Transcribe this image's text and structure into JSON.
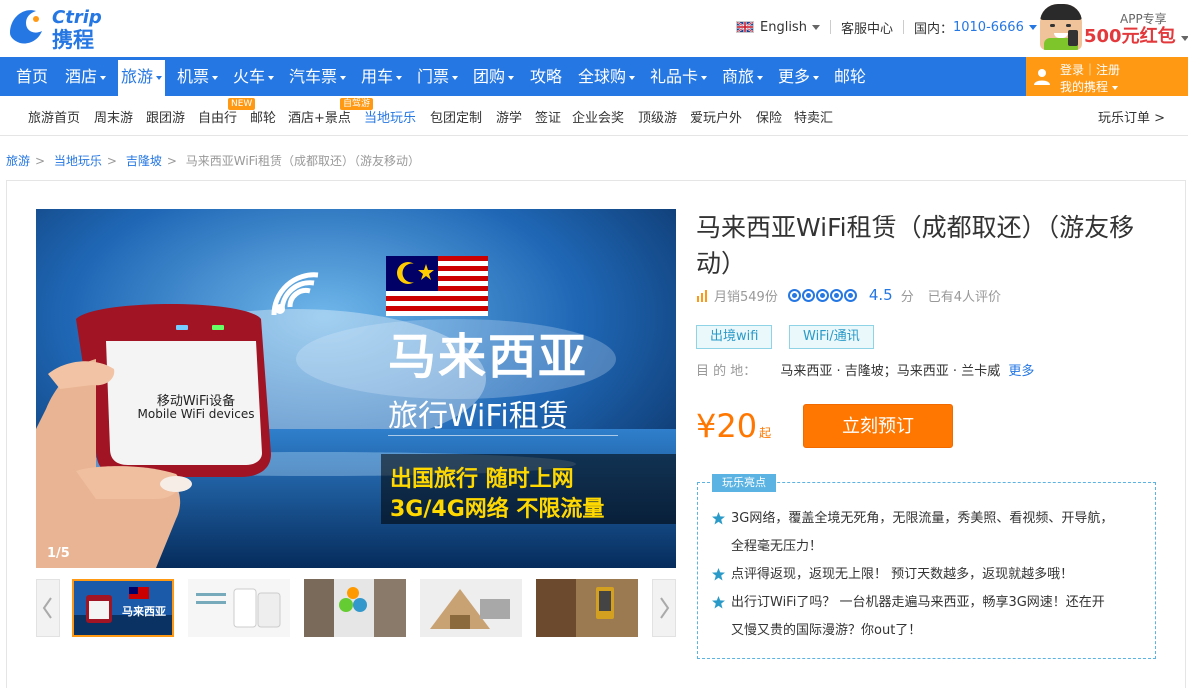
{
  "brand": {
    "name": "携程",
    "logo_text": "Ctrip"
  },
  "topbar": {
    "language": "English",
    "service": "客服中心",
    "phone_label": "国内：",
    "phone_number": "1010-6666",
    "promo_tag": "APP专享",
    "promo_money": "500元红包"
  },
  "mainnav": {
    "items": [
      {
        "label": "首页"
      },
      {
        "label": "酒店"
      },
      {
        "label": "旅游"
      },
      {
        "label": "机票"
      },
      {
        "label": "火车"
      },
      {
        "label": "汽车票"
      },
      {
        "label": "用车"
      },
      {
        "label": "门票"
      },
      {
        "label": "团购"
      },
      {
        "label": "攻略"
      },
      {
        "label": "全球购"
      },
      {
        "label": "礼品卡"
      },
      {
        "label": "商旅"
      },
      {
        "label": "更多"
      },
      {
        "label": "邮轮"
      }
    ],
    "login": "登录｜注册",
    "my_ctrip": "我的携程"
  },
  "subnav": {
    "items": [
      {
        "label": "旅游首页"
      },
      {
        "label": "周末游"
      },
      {
        "label": "跟团游"
      },
      {
        "label": "自由行"
      },
      {
        "label": "邮轮"
      },
      {
        "label": "酒店+景点"
      },
      {
        "label": "当地玩乐"
      },
      {
        "label": "包团定制"
      },
      {
        "label": "游学"
      },
      {
        "label": "签证"
      },
      {
        "label": "企业会奖"
      },
      {
        "label": "顶级游"
      },
      {
        "label": "爱玩户外"
      },
      {
        "label": "保险"
      },
      {
        "label": "特卖汇"
      }
    ],
    "badge_new": "NEW",
    "badge_self_drive": "自驾游",
    "orders": "玩乐订单 >"
  },
  "breadcrumb": {
    "items": [
      "旅游",
      "当地玩乐",
      "吉隆坡"
    ],
    "current": "马来西亚WiFi租赁（成都取还）（游友移动）"
  },
  "gallery": {
    "counter": "1/5",
    "hero_device_cn": "移动WiFi设备",
    "hero_device_en": "Mobile WiFi devices",
    "hero_title": "马来西亚",
    "hero_subtitle": "旅行WiFi租赁",
    "hero_line1": "出国旅行 随时上网",
    "hero_line2": "3G/4G网络 不限流量",
    "thumb1_title": "马来西亚"
  },
  "product": {
    "title": "马来西亚WiFi租赁（成都取还）（游友移动）",
    "monthly_sales": "月销549份",
    "rating": 4.5,
    "score": "4.5",
    "score_unit": "分",
    "reviews": "已有4人评价",
    "tags": [
      "出境wifi",
      "WiFi/通讯"
    ],
    "dest_label": "目 的 地：",
    "dest_value": "马来西亚 · 吉隆坡；马来西亚 · 兰卡威",
    "dest_more": "更多",
    "price": "¥20",
    "price_unit": "起",
    "book": "立刻预订",
    "highlights_label": "玩乐亮点",
    "highlights": [
      "3G网络，覆盖全境无死角，无限流量，秀美照、看视频、开导航，",
      "全程毫无压力！",
      "点评得返现，返现无上限！ 预订天数越多，返现就越多哦！",
      "出行订WiFi了吗？ 一台机器走遍马来西亚，畅享3G网速！还在开",
      "又慢又贵的国际漫游？你out了！"
    ]
  },
  "colors": {
    "nav_blue": "#2577e3",
    "orange": "#ff7700",
    "login_orange": "#ff9913",
    "tag_blue": "#2a9bc9"
  }
}
